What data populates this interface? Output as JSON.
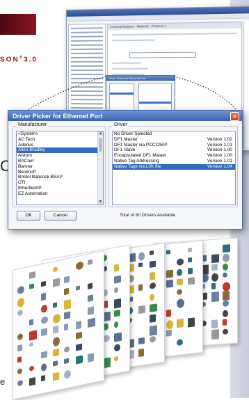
{
  "brand": {
    "suffix": "SON",
    "version": "3.0",
    "stray_left_char": "C",
    "stray_bottom_char": "e"
  },
  "background_window": {
    "title": "",
    "panel_title": "Communications - Network - Protocol 1"
  },
  "driver_picker": {
    "title": "Driver Picker for Ethernet Port",
    "manufacturer_label": "Manufacturer",
    "driver_label": "Driver",
    "manufacturers": [
      "<System>",
      "AC Tech",
      "Adenus",
      "Allen-Bradley",
      "Alstom",
      "BACnet",
      "Banner",
      "Beckhoff",
      "Bristol Babcock BSAP",
      "CTI",
      "EtherNet/IP",
      "EZ Automation"
    ],
    "selected_manufacturer": "Allen-Bradley",
    "drivers": [
      {
        "name": "No Driver Selected",
        "version": ""
      },
      {
        "name": "DF1 Master",
        "version": "Version 1.02"
      },
      {
        "name": "DF1 Master via PCCC/EIP",
        "version": "Version 1.01"
      },
      {
        "name": "DF1 Slave",
        "version": "Version 1.00"
      },
      {
        "name": "Encapsulated DF1 Master",
        "version": "Version 1.00"
      },
      {
        "name": "Native Tag Addressing",
        "version": "Version 1.01"
      },
      {
        "name": "Native Tags via L5K file",
        "version": "Version 1.04"
      }
    ],
    "selected_driver": "Native Tags via L5K file",
    "ok_label": "OK",
    "cancel_label": "Cancel",
    "total_text": "Total of 60 Drivers Available.",
    "accent_color": "#3b61b0",
    "selection_color": "#316ac5"
  },
  "icons": [
    "close-icon",
    "scroll-up-icon",
    "scroll-down-icon"
  ]
}
